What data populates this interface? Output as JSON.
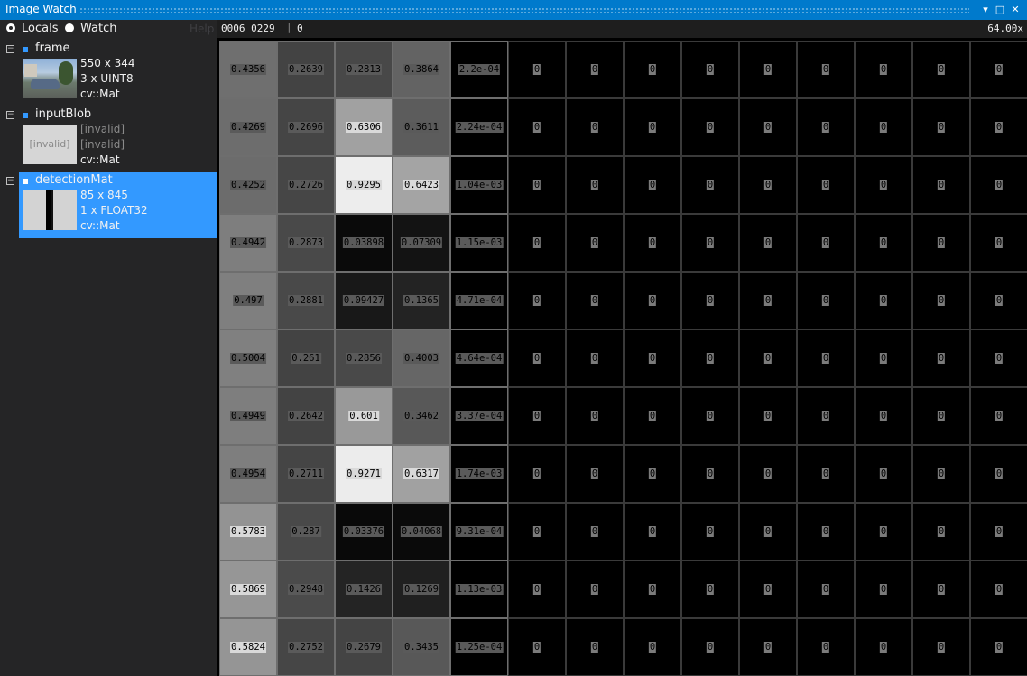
{
  "window": {
    "title": "Image Watch",
    "accent": "#007acc"
  },
  "controls": {
    "dropdown_icon": "▾",
    "maximize_icon": "□",
    "close_icon": "✕"
  },
  "scope": {
    "options": [
      "Locals",
      "Watch"
    ],
    "selected": "Locals",
    "help_label": "Help"
  },
  "variables": [
    {
      "name": "frame",
      "line1": "550 x 344",
      "line2": "3 x UINT8",
      "type": "cv::Mat",
      "thumbnail": "car-photo",
      "selected": false
    },
    {
      "name": "inputBlob",
      "line1": "[invalid]",
      "line2": "[invalid]",
      "type": "cv::Mat",
      "thumbnail_text": "[invalid]",
      "selected": false
    },
    {
      "name": "detectionMat",
      "line1": "85 x 845",
      "line2": "1 x FLOAT32",
      "type": "cv::Mat",
      "thumbnail": "grayscale-strip",
      "selected": true
    }
  ],
  "viewer": {
    "coords": "0006 0229",
    "separator": "|",
    "pixel_value": "0",
    "zoom": "64.00x",
    "columns": 14,
    "rows": [
      [
        "0.4356",
        "0.2639",
        "0.2813",
        "0.3864",
        "2.2e-04",
        "0",
        "0",
        "0",
        "0",
        "0",
        "0",
        "0",
        "0",
        "0"
      ],
      [
        "0.4269",
        "0.2696",
        "0.6306",
        "0.3611",
        "2.24e-04",
        "0",
        "0",
        "0",
        "0",
        "0",
        "0",
        "0",
        "0",
        "0"
      ],
      [
        "0.4252",
        "0.2726",
        "0.9295",
        "0.6423",
        "1.04e-03",
        "0",
        "0",
        "0",
        "0",
        "0",
        "0",
        "0",
        "0",
        "0"
      ],
      [
        "0.4942",
        "0.2873",
        "0.03898",
        "0.07309",
        "1.15e-03",
        "0",
        "0",
        "0",
        "0",
        "0",
        "0",
        "0",
        "0",
        "0"
      ],
      [
        "0.497",
        "0.2881",
        "0.09427",
        "0.1365",
        "4.71e-04",
        "0",
        "0",
        "0",
        "0",
        "0",
        "0",
        "0",
        "0",
        "0"
      ],
      [
        "0.5004",
        "0.261",
        "0.2856",
        "0.4003",
        "4.64e-04",
        "0",
        "0",
        "0",
        "0",
        "0",
        "0",
        "0",
        "0",
        "0"
      ],
      [
        "0.4949",
        "0.2642",
        "0.601",
        "0.3462",
        "3.37e-04",
        "0",
        "0",
        "0",
        "0",
        "0",
        "0",
        "0",
        "0",
        "0"
      ],
      [
        "0.4954",
        "0.2711",
        "0.9271",
        "0.6317",
        "1.74e-03",
        "0",
        "0",
        "0",
        "0",
        "0",
        "0",
        "0",
        "0",
        "0"
      ],
      [
        "0.5783",
        "0.287",
        "0.03376",
        "0.04068",
        "9.31e-04",
        "0",
        "0",
        "0",
        "0",
        "0",
        "0",
        "0",
        "0",
        "0"
      ],
      [
        "0.5869",
        "0.2948",
        "0.1426",
        "0.1269",
        "1.13e-03",
        "0",
        "0",
        "0",
        "0",
        "0",
        "0",
        "0",
        "0",
        "0"
      ],
      [
        "0.5824",
        "0.2752",
        "0.2679",
        "0.3435",
        "1.25e-04",
        "0",
        "0",
        "0",
        "0",
        "0",
        "0",
        "0",
        "0",
        "0"
      ]
    ]
  }
}
